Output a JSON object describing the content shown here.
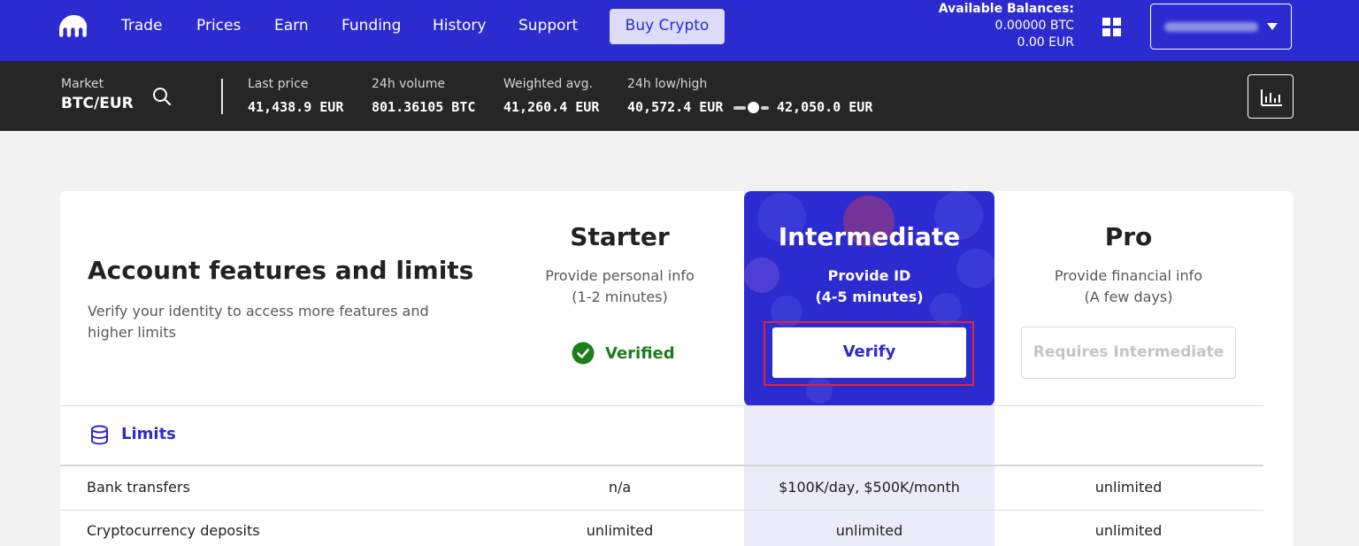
{
  "nav": {
    "items": [
      "Trade",
      "Prices",
      "Earn",
      "Funding",
      "History",
      "Support"
    ],
    "buy_label": "Buy Crypto",
    "balances_title": "Available Balances:",
    "balance_btc": "0.00000 BTC",
    "balance_eur": "0.00 EUR",
    "accent": "#2b2bd0"
  },
  "market": {
    "market_label": "Market",
    "pair": "BTC/EUR",
    "last_price_label": "Last price",
    "last_price": "41,438.9 EUR",
    "volume_label": "24h volume",
    "volume": "801.36105 BTC",
    "wavg_label": "Weighted avg.",
    "wavg": "41,260.4 EUR",
    "lowhigh_label": "24h low/high",
    "low": "40,572.4 EUR",
    "high": "42,050.0 EUR"
  },
  "features": {
    "title": "Account features and limits",
    "subtitle": "Verify your identity to access more features and higher limits",
    "tiers": [
      {
        "name": "Starter",
        "desc1": "Provide personal info",
        "desc2": "(1-2 minutes)",
        "status": "Verified"
      },
      {
        "name": "Intermediate",
        "desc1": "Provide ID",
        "desc2": "(4-5 minutes)",
        "action": "Verify"
      },
      {
        "name": "Pro",
        "desc1": "Provide financial info",
        "desc2": "(A few days)",
        "action": "Requires Intermediate"
      }
    ],
    "limits_label": "Limits",
    "rows": [
      {
        "label": "Bank transfers",
        "values": [
          "n/a",
          "$100K/day, $500K/month",
          "unlimited"
        ]
      },
      {
        "label": "Cryptocurrency deposits",
        "values": [
          "unlimited",
          "unlimited",
          "unlimited"
        ]
      }
    ]
  }
}
